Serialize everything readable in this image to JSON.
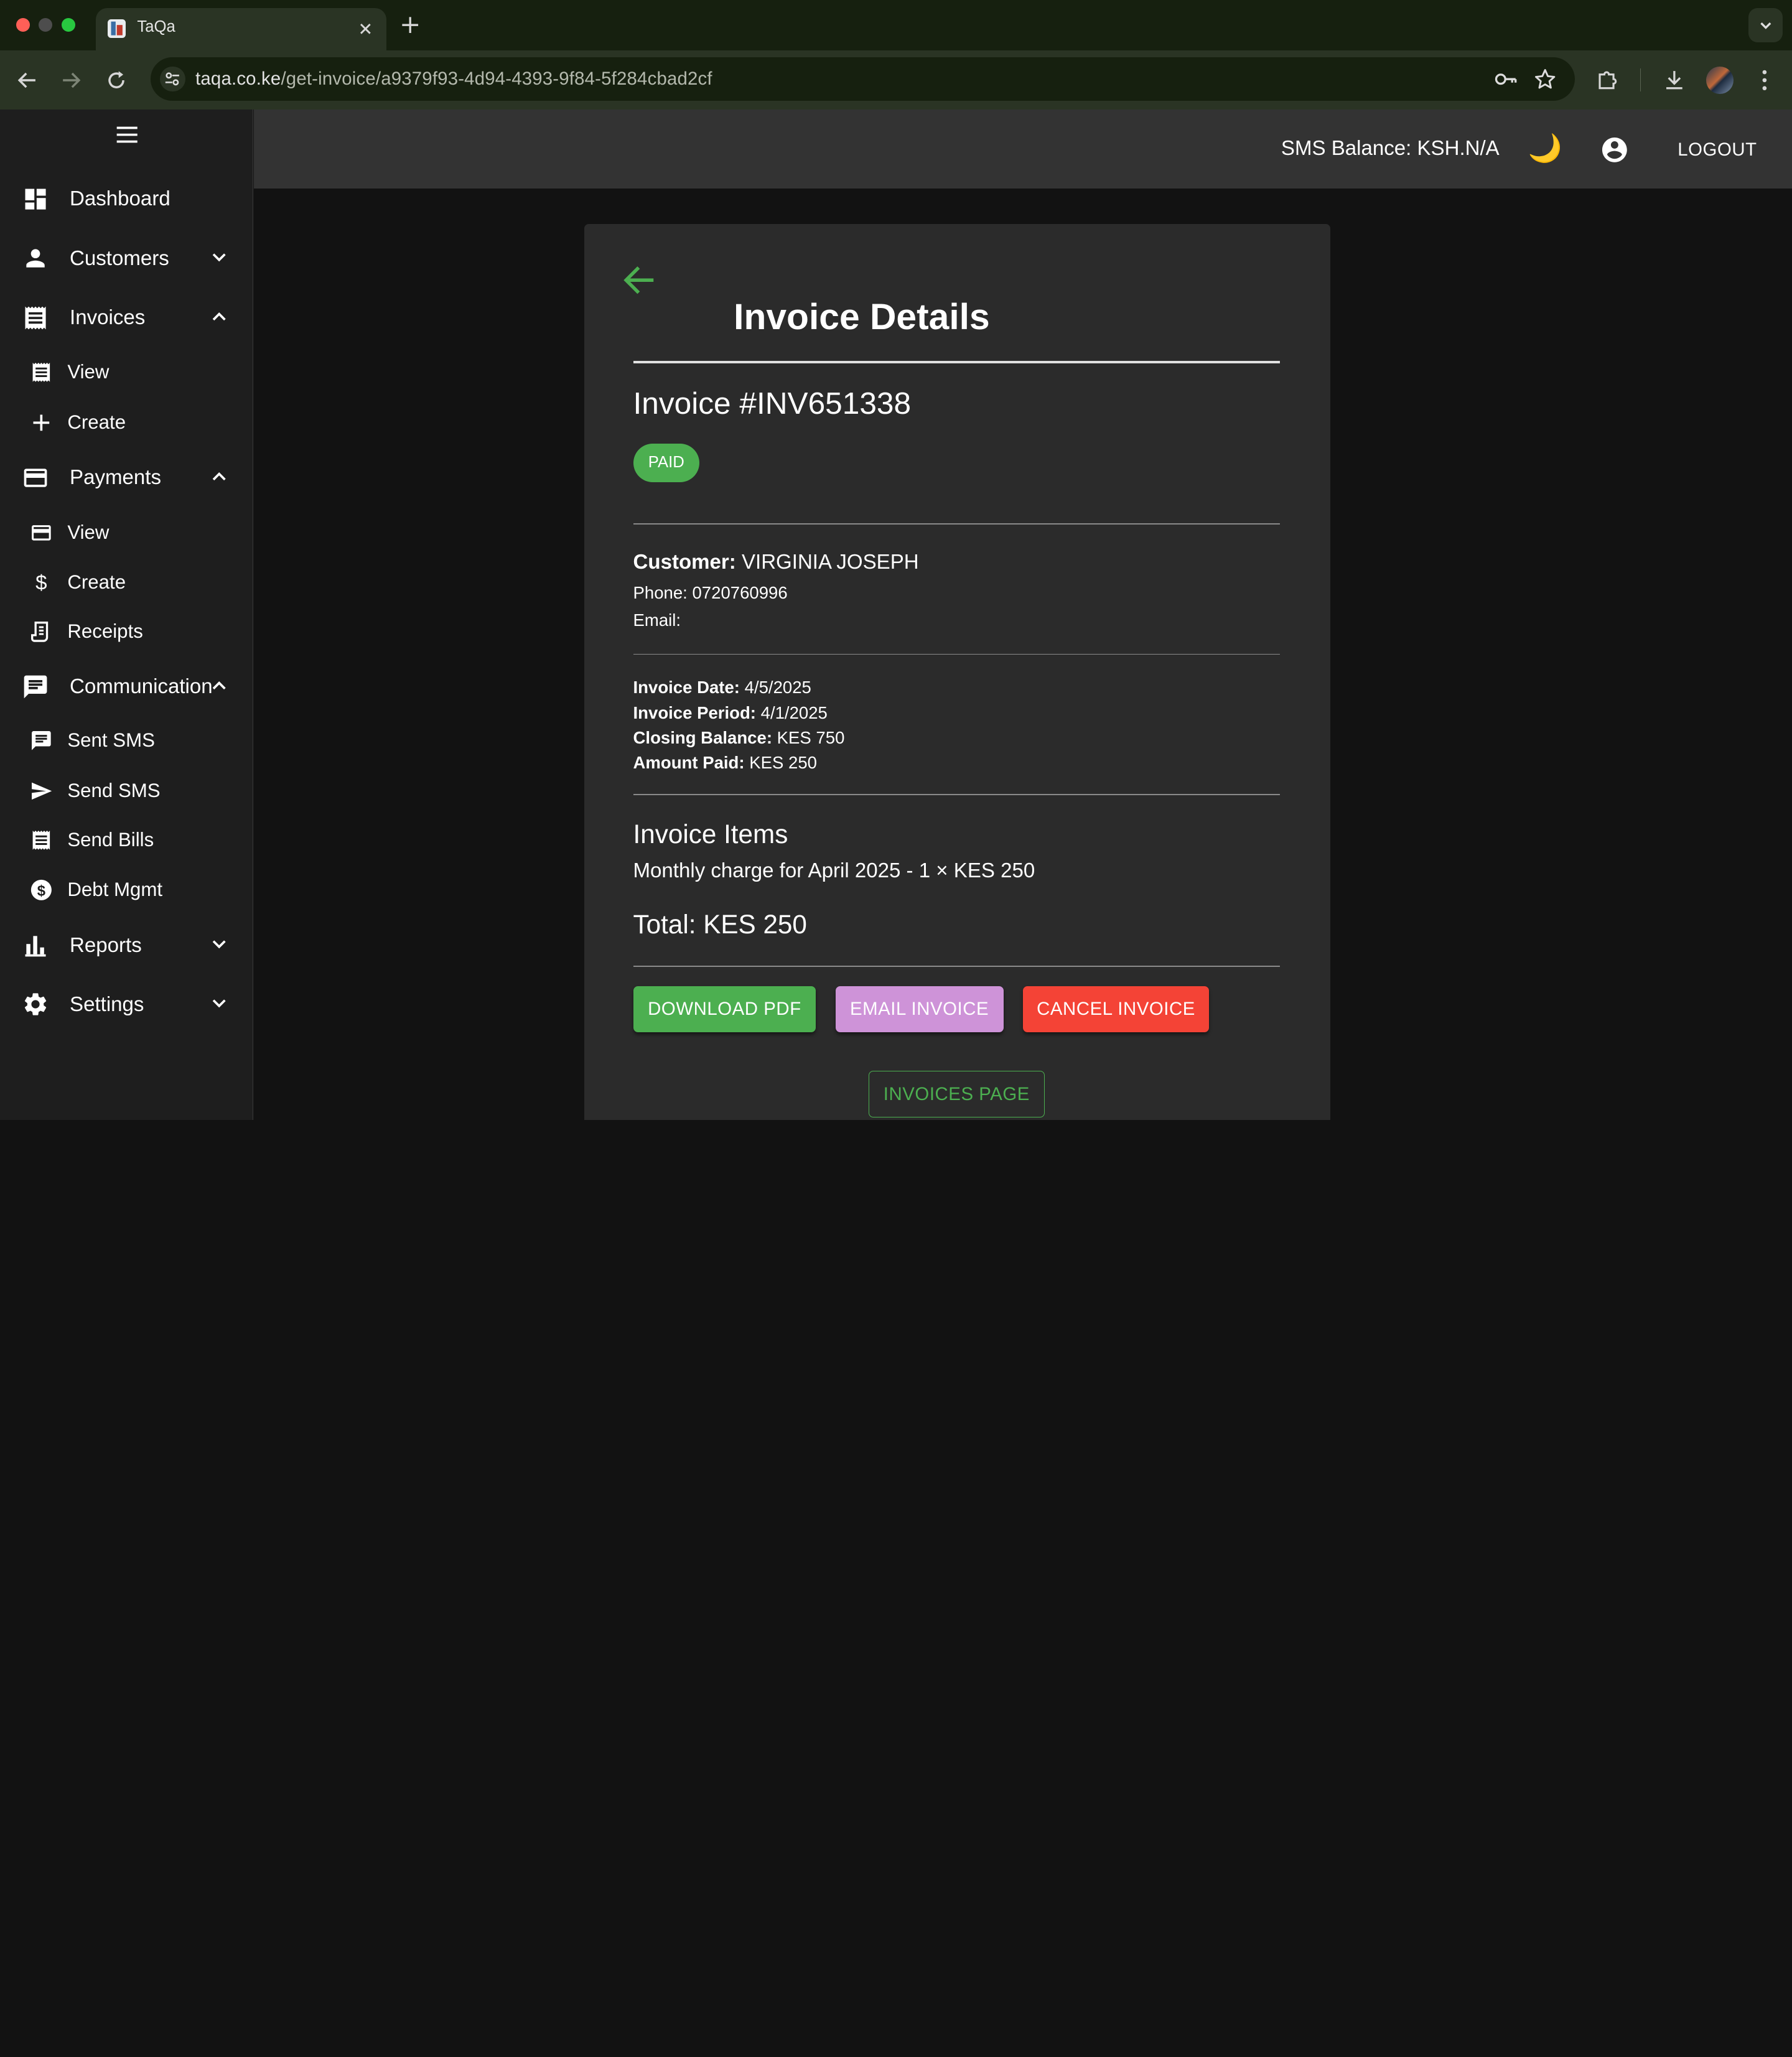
{
  "browser": {
    "tab_title": "TaQa",
    "url_host": "taqa.co.ke",
    "url_path": "/get-invoice/a9379f93-4d94-4393-9f84-5f284cbad2cf"
  },
  "sidebar": {
    "items": [
      {
        "label": "Dashboard",
        "icon": "dashboard-icon"
      },
      {
        "label": "Customers",
        "icon": "person-icon",
        "expanded": false
      },
      {
        "label": "Invoices",
        "icon": "receipt-icon",
        "expanded": true,
        "children": [
          {
            "label": "View",
            "icon": "receipt-icon"
          },
          {
            "label": "Create",
            "icon": "plus-icon"
          }
        ]
      },
      {
        "label": "Payments",
        "icon": "credit-card-icon",
        "expanded": true,
        "children": [
          {
            "label": "View",
            "icon": "credit-card-icon"
          },
          {
            "label": "Create",
            "icon": "dollar-icon"
          },
          {
            "label": "Receipts",
            "icon": "receipt-long-icon"
          }
        ]
      },
      {
        "label": "Communication",
        "icon": "chat-icon",
        "expanded": true,
        "children": [
          {
            "label": "Sent SMS",
            "icon": "chat-icon"
          },
          {
            "label": "Send SMS",
            "icon": "send-icon"
          },
          {
            "label": "Send Bills",
            "icon": "receipt-icon"
          },
          {
            "label": "Debt Mgmt",
            "icon": "money-circle-icon"
          }
        ]
      },
      {
        "label": "Reports",
        "icon": "bar-chart-icon",
        "expanded": false
      },
      {
        "label": "Settings",
        "icon": "gear-icon",
        "expanded": false
      }
    ]
  },
  "header": {
    "sms_balance": "SMS Balance: KSH.N/A",
    "theme_icon": "🌙",
    "logout_label": "LOGOUT"
  },
  "invoice": {
    "page_title": "Invoice Details",
    "number": "Invoice #INV651338",
    "status": "PAID",
    "customer_label": "Customer:",
    "customer_name": "VIRGINIA JOSEPH",
    "phone": "Phone: 0720760996",
    "email": "Email:",
    "date_label": "Invoice Date:",
    "date": "4/5/2025",
    "period_label": "Invoice Period:",
    "period": "4/1/2025",
    "closing_label": "Closing Balance:",
    "closing": "KES 750",
    "paid_label": "Amount Paid:",
    "paid": "KES 250",
    "items_heading": "Invoice Items",
    "items": [
      "Monthly charge for April 2025 - 1 × KES 250"
    ],
    "total": "Total: KES 250"
  },
  "actions": {
    "download_pdf": "DOWNLOAD PDF",
    "email_invoice": "EMAIL INVOICE",
    "cancel_invoice": "CANCEL INVOICE",
    "invoices_page": "INVOICES PAGE"
  },
  "colors": {
    "accent_green": "#4caf50",
    "email_purple": "#ce93d8",
    "danger_red": "#f44336"
  }
}
